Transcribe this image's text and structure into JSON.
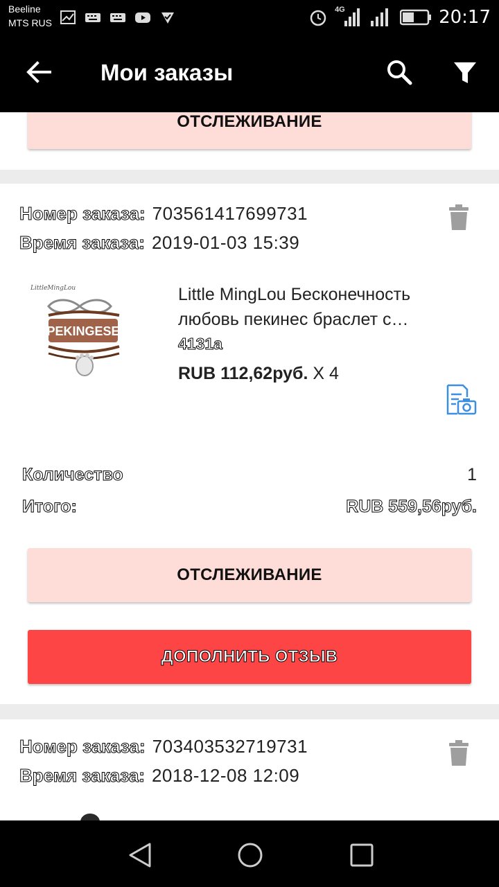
{
  "status_bar": {
    "carrier1": "Beeline",
    "carrier2": "MTS RUS",
    "network": "4G",
    "time": "20:17"
  },
  "app_bar": {
    "title": "Мои заказы",
    "icons": [
      "back-arrow-icon",
      "search-icon",
      "filter-icon"
    ]
  },
  "orders": [
    {
      "track_label": "ОТСЛЕЖИВАНИЕ"
    },
    {
      "order_number_label": "Номер заказа:",
      "order_number": "703561417699731",
      "order_time_label": "Время заказа:",
      "order_time": "2019-01-03 15:39",
      "product": {
        "image_text": "PEKINGESE",
        "title": "Little MingLou Бесконечность любовь пекинес браслет с…",
        "sku": "4131a",
        "price": "RUB 112,62руб.",
        "qty_text": "X 4"
      },
      "quantity_label": "Количество",
      "quantity_value": "1",
      "total_label": "Итого:",
      "total_value": "RUB 559,56руб.",
      "track_label": "ОТСЛЕЖИВАНИЕ",
      "review_label": "ДОПОЛНИТЬ ОТЗЫВ"
    },
    {
      "order_number_label": "Номер заказа:",
      "order_number": "703403532719731",
      "order_time_label": "Время заказа:",
      "order_time": "2018-12-08 12:09"
    }
  ],
  "colors": {
    "track_button": "#fedcd8",
    "review_button": "#fe4545",
    "accent_icon": "#3b8ee0"
  }
}
